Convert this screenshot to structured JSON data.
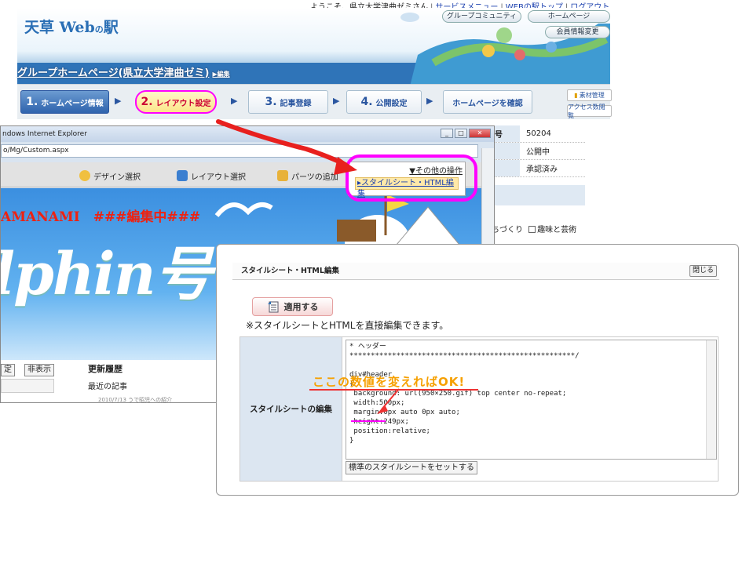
{
  "header": {
    "top_nav": {
      "greeting": "ようこそ、県立大学津曲ゼミさん",
      "links": [
        "サービスメニュー",
        "WEBの駅トップ",
        "ログアウト"
      ]
    },
    "logo": {
      "main": "天草 Web",
      "no": "の",
      "eki": "駅"
    },
    "buttons": [
      "グループコミュニティ",
      "ホームページ",
      "会員情報変更"
    ],
    "group_title": "グループホームページ(県立大学津曲ゼミ)",
    "edit_link": "▶編集"
  },
  "steps": [
    {
      "num": "1.",
      "label": "ホームページ情報"
    },
    {
      "num": "2.",
      "label": "レイアウト設定"
    },
    {
      "num": "3.",
      "label": "記事登録"
    },
    {
      "num": "4.",
      "label": "公開設定"
    },
    {
      "num": "",
      "label": "ホームページを確認"
    }
  ],
  "side_buttons": [
    "素材管理",
    "アクセス数閲覧"
  ],
  "info_table": [
    {
      "key": "号",
      "value": "50204"
    },
    {
      "key": "",
      "value": "公開中"
    },
    {
      "key": "",
      "value": "承認済み"
    }
  ],
  "info_extra": "ちづくり",
  "info_checkbox": "趣味と芸術",
  "ie": {
    "title": "ndows Internet Explorer",
    "address": "o/Mg/Custom.aspx",
    "toolbar": [
      "デザイン選択",
      "レイアウト選択",
      "パーツの追加"
    ],
    "editing_text": "AMANAMI　###編集中###",
    "big_text": "lphin号",
    "lower": {
      "btn_a": "定",
      "btn_b": "非表示",
      "heading": "更新履歴",
      "subheading": "最近の記事",
      "cut_item": "2010/7/13  うで昭児への紹介"
    }
  },
  "menu": {
    "head": "▼その他の操作",
    "item": "▸スタイルシート・HTML編集"
  },
  "dialog": {
    "title": "スタイルシート・HTML編集",
    "close": "閉じる",
    "apply": "適用する",
    "note": "※スタイルシートとHTMLを直接編集できます。",
    "row_label": "スタイルシートの編集",
    "code": "* ヘッダー\n*****************************************************/\n\ndiv#header\n{\n background: url(950×250.gif) top center no-repeat;\n width:500px;\n margin:0px auto 0px auto;\n height:249px;\n position:relative;\n}",
    "reset": "標準のスタイルシートをセットする",
    "tip": "ここの数値を変えればOK!"
  },
  "colors": {
    "highlight": "#ff00ff",
    "arrow": "#e8201e",
    "tip": "#f6a000"
  }
}
